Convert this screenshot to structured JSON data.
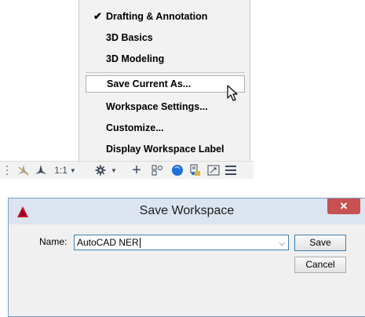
{
  "workspace_menu": {
    "items": [
      {
        "label": "Drafting & Annotation",
        "checked": true
      },
      {
        "label": "3D Basics"
      },
      {
        "label": "3D Modeling"
      },
      {
        "label": "Save Current As...",
        "highlighted": true
      },
      {
        "label": "Workspace Settings..."
      },
      {
        "label": "Customize..."
      },
      {
        "label": "Display Workspace Label"
      }
    ],
    "check_glyph": "✔"
  },
  "toolbar": {
    "annotation_scale": "1:1",
    "icons": [
      "annotation-visibility-icon",
      "annotation-autoscale-icon",
      "annotation-scale-dropdown",
      "workspace-gear-icon",
      "add-icon",
      "units-icon",
      "quick-properties-icon",
      "lock-ui-icon",
      "fullscreen-icon",
      "customization-menu-icon"
    ]
  },
  "dialog": {
    "title": "Save Workspace",
    "close_glyph": "✕",
    "name_label": "Name:",
    "name_value": "AutoCAD NER",
    "save_label": "Save",
    "cancel_label": "Cancel",
    "accent_color": "#3c7fb1",
    "close_color": "#c75050"
  }
}
